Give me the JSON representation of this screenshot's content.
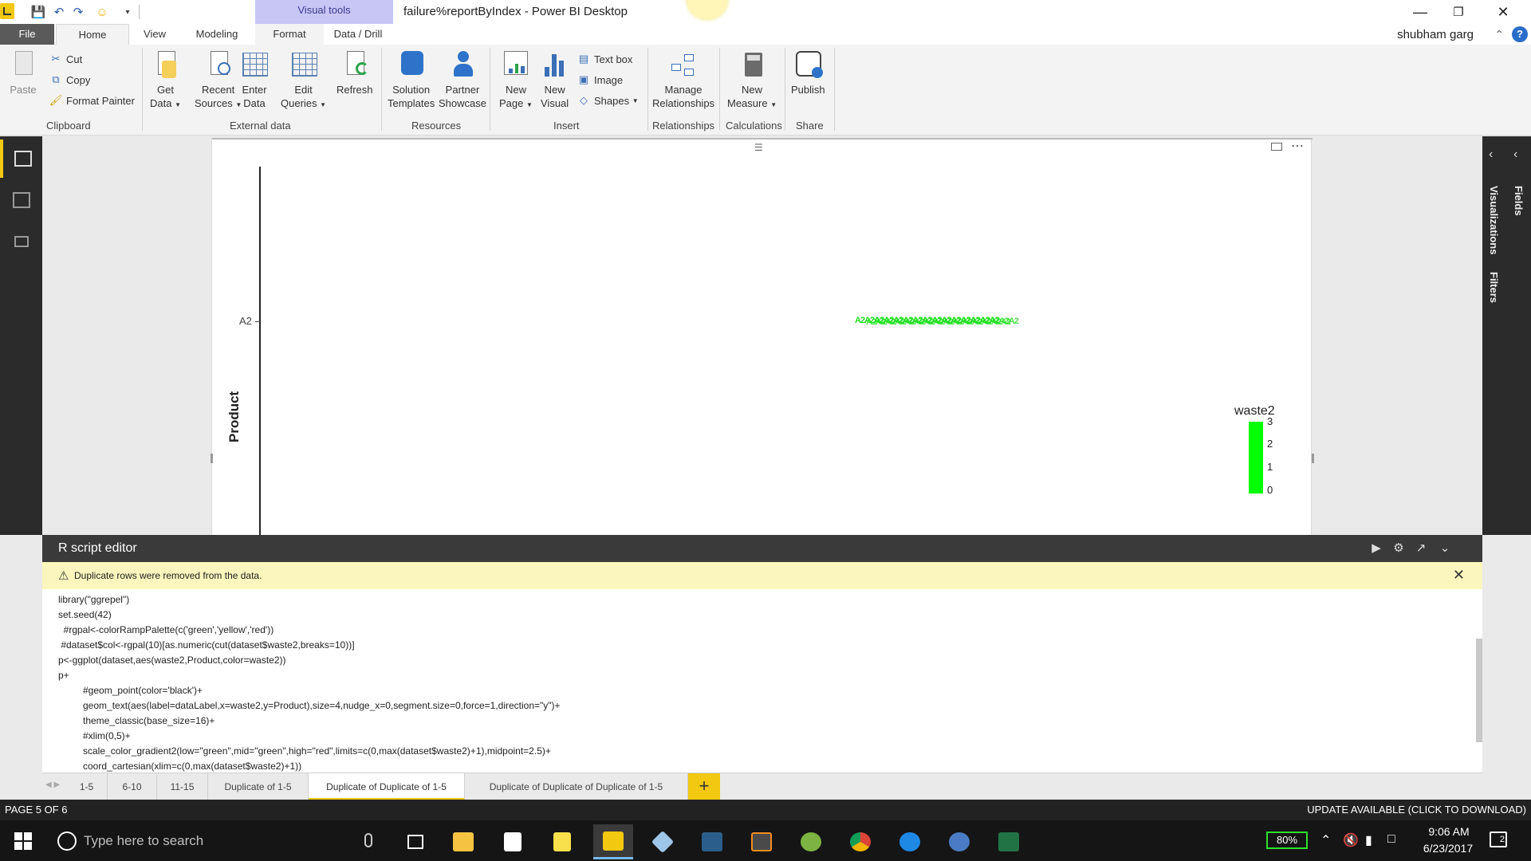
{
  "window": {
    "title": "failure%reportByIndex - Power BI Desktop",
    "context_tab": "Visual tools",
    "user": "shubham garg",
    "help_label": "?"
  },
  "tabs": [
    "File",
    "Home",
    "View",
    "Modeling",
    "Format",
    "Data / Drill"
  ],
  "ribbon": {
    "clipboard": {
      "paste": "Paste",
      "cut": "Cut",
      "copy": "Copy",
      "format_painter": "Format Painter",
      "group": "Clipboard"
    },
    "external_data": {
      "get_data": [
        "Get",
        "Data"
      ],
      "recent_sources": [
        "Recent",
        "Sources"
      ],
      "enter_data": [
        "Enter",
        "Data"
      ],
      "edit_queries": [
        "Edit",
        "Queries"
      ],
      "refresh": "Refresh",
      "group": "External data"
    },
    "resources": {
      "solution_templates": [
        "Solution",
        "Templates"
      ],
      "partner_showcase": [
        "Partner",
        "Showcase"
      ],
      "group": "Resources"
    },
    "insert": {
      "new_page": [
        "New",
        "Page"
      ],
      "new_visual": [
        "New",
        "Visual"
      ],
      "text_box": "Text box",
      "image": "Image",
      "shapes": "Shapes",
      "group": "Insert"
    },
    "relationships": {
      "manage": [
        "Manage",
        "Relationships"
      ],
      "group": "Relationships"
    },
    "calculations": {
      "new_measure": [
        "New",
        "Measure"
      ],
      "group": "Calculations"
    },
    "share": {
      "publish": "Publish",
      "group": "Share"
    }
  },
  "right_panes": {
    "visualizations": "Visualizations",
    "filters": "Filters",
    "fields": "Fields"
  },
  "visual": {
    "y_axis_label": "Product",
    "y_tick": "A2",
    "data_label_text": "A2A2A2A2A2A2A2A2A2A2A2A2A2A2A2",
    "legend_title": "waste2",
    "legend_ticks": [
      "3",
      "2",
      "1",
      "0"
    ],
    "point_color": "#00ff00"
  },
  "r_editor": {
    "title": "R script editor",
    "warning": "Duplicate rows were removed from the data.",
    "code": [
      {
        "text": "library(\"ggrepel\")",
        "indent": false
      },
      {
        "text": "set.seed(42)",
        "indent": false
      },
      {
        "text": "  #rgpal<-colorRampPalette(c('green','yellow','red'))",
        "indent": false
      },
      {
        "text": " #dataset$col<-rgpal(10)[as.numeric(cut(dataset$waste2,breaks=10))]",
        "indent": false
      },
      {
        "text": "p<-ggplot(dataset,aes(waste2,Product,color=waste2))",
        "indent": false
      },
      {
        "text": "p+",
        "indent": false
      },
      {
        "text": "#geom_point(color='black')+",
        "indent": true
      },
      {
        "text": "geom_text(aes(label=dataLabel,x=waste2,y=Product),size=4,nudge_x=0,segment.size=0,force=1,direction=\"y\")+",
        "indent": true
      },
      {
        "text": "theme_classic(base_size=16)+",
        "indent": true
      },
      {
        "text": "#xlim(0,5)+",
        "indent": true
      },
      {
        "text": "scale_color_gradient2(low=\"green\",mid=\"green\",high=\"red\",limits=c(0,max(dataset$waste2)+1),midpoint=2.5)+",
        "indent": true
      },
      {
        "text": "coord_cartesian(xlim=c(0,max(dataset$waste2)+1))",
        "indent": true
      }
    ]
  },
  "page_tabs": [
    "1-5",
    "6-10",
    "11-15",
    "Duplicate of 1-5",
    "Duplicate of Duplicate of 1-5",
    "Duplicate of Duplicate of Duplicate of 1-5"
  ],
  "active_page_tab": 4,
  "add_page_label": "+",
  "status": {
    "page": "PAGE 5 OF 6",
    "update": "UPDATE AVAILABLE (CLICK TO DOWNLOAD)"
  },
  "taskbar": {
    "search_placeholder": "Type here to search",
    "battery": "80%",
    "time": "9:06 AM",
    "date": "6/23/2017",
    "notifications": "2",
    "apps": [
      "file-explorer",
      "store",
      "sticky-notes",
      "power-bi",
      "app-3d",
      "visual-studio",
      "sublime",
      "android-studio",
      "chrome",
      "edge",
      "r-gui",
      "excel"
    ]
  },
  "colors": {
    "accent": "#f2c811",
    "context_tab": "#c8c6f5",
    "warning_bg": "#fbf6bd",
    "legend": "#00ff00"
  }
}
